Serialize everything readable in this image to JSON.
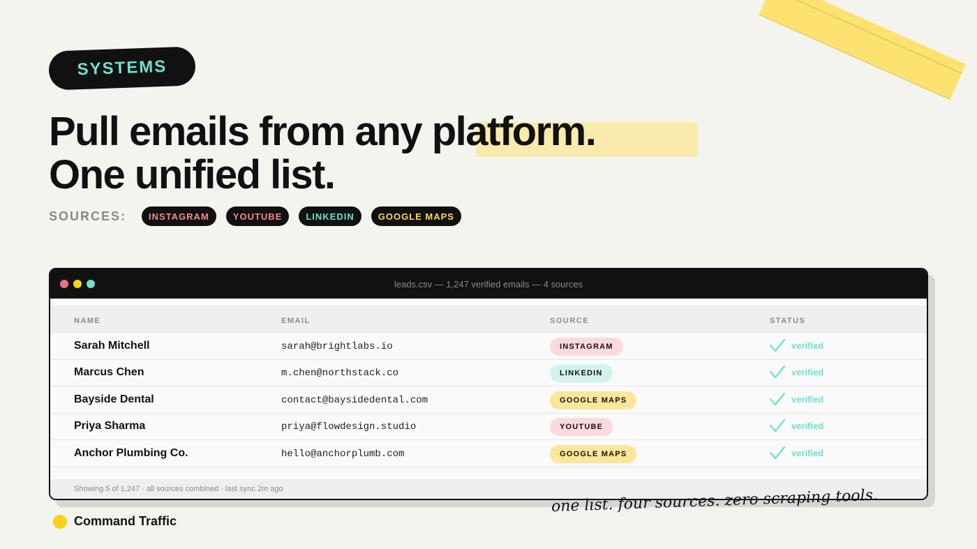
{
  "badge": "SYSTEMS",
  "headline": {
    "line1": "Pull emails from any platform.",
    "line2": "One unified list."
  },
  "sources": {
    "label": "SOURCES:",
    "chips": [
      {
        "label": "INSTAGRAM",
        "color": "#f28b8b"
      },
      {
        "label": "YOUTUBE",
        "color": "#f28b8b"
      },
      {
        "label": "LINKEDIN",
        "color": "#6de0cf"
      },
      {
        "label": "GOOGLE MAPS",
        "color": "#fdd85a"
      }
    ]
  },
  "window": {
    "title": "leads.csv — 1,247 verified emails — 4 sources",
    "dots": [
      "#f07080",
      "#fcd116",
      "#6de0cf"
    ],
    "columns": [
      "NAME",
      "EMAIL",
      "SOURCE",
      "STATUS"
    ],
    "rows": [
      {
        "name": "Sarah Mitchell",
        "email": "sarah@brightlabs.io",
        "source": "INSTAGRAM",
        "source_bg": "#fbdadd",
        "status": "verified"
      },
      {
        "name": "Marcus Chen",
        "email": "m.chen@northstack.co",
        "source": "LINKEDIN",
        "source_bg": "#d3f3ee",
        "status": "verified"
      },
      {
        "name": "Bayside Dental",
        "email": "contact@baysidedental.com",
        "source": "GOOGLE MAPS",
        "source_bg": "#fbe79a",
        "status": "verified"
      },
      {
        "name": "Priya Sharma",
        "email": "priya@flowdesign.studio",
        "source": "YOUTUBE",
        "source_bg": "#fbdadd",
        "status": "verified"
      },
      {
        "name": "Anchor Plumbing Co.",
        "email": "hello@anchorplumb.com",
        "source": "GOOGLE MAPS",
        "source_bg": "#fbe79a",
        "status": "verified"
      }
    ],
    "footer": "Showing 5 of 1,247 · all sources combined · last sync 2m ago"
  },
  "brand": "Command Traffic",
  "tagline": "one list. four sources. zero scraping tools.",
  "colors": {
    "accent_teal": "#6de0cf",
    "accent_yellow": "#fcd116",
    "dark": "#111111"
  }
}
